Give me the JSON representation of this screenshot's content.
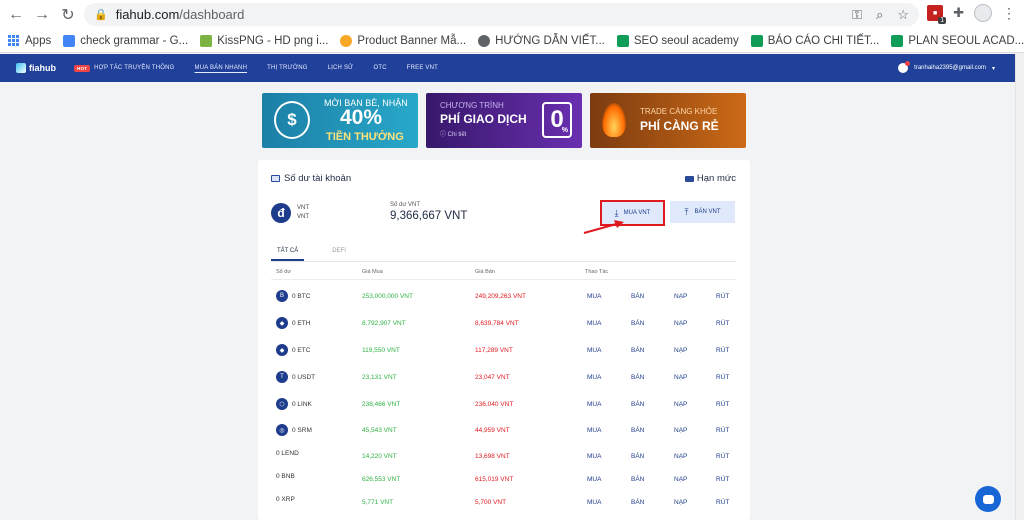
{
  "browser": {
    "url_host": "fiahub.com",
    "url_path": "/dashboard",
    "bookmarks": [
      {
        "label": "Apps",
        "color": "#4285f4"
      },
      {
        "label": "check grammar - G...",
        "color": "#4285f4"
      },
      {
        "label": "KissPNG - HD png i...",
        "color": "#7cb342"
      },
      {
        "label": "Product Banner Mẫ...",
        "color": "#f9a825"
      },
      {
        "label": "HƯỚNG DẪN VIẾT...",
        "color": "#4285f4"
      },
      {
        "label": "SEO seoul academy",
        "color": "#0f9d58"
      },
      {
        "label": "BÁO CÁO CHI TIẾT...",
        "color": "#0f9d58"
      },
      {
        "label": "PLAN SEOUL ACAD...",
        "color": "#0f9d58"
      }
    ],
    "ext_badge_count": "1"
  },
  "nav": {
    "logo": "fiahub",
    "hot": "HOT",
    "items": [
      "HỢP TÁC TRUYỀN THÔNG",
      "MUA BÁN NHANH",
      "THỊ TRƯỜNG",
      "LỊCH SỬ",
      "OTC",
      "FREE VNT"
    ],
    "active_index": 1,
    "user_email": "tranhaiha2395@gmail.com",
    "caret": "▾"
  },
  "banners": {
    "b1_line1": "MỜI BẠN BÈ, NHẬN",
    "b1_percent": "40%",
    "b1_line3": "TIỀN THƯỞNG",
    "b2_line1": "CHƯƠNG TRÌNH",
    "b2_line2": "PHÍ GIAO DỊCH",
    "b2_detail": "Chi tiết",
    "b2_zero": "0",
    "b2_pct": "%",
    "b3_line1": "TRADE CÀNG KHỎE",
    "b3_line2": "PHÍ CÀNG RẺ"
  },
  "account": {
    "title": "Số dư tài khoản",
    "limit_link": "Hạn mức",
    "currency_code": "VNT",
    "currency_name": "VNT",
    "balance_caption": "Số dư VNT",
    "balance_value": "9,366,667 VNT",
    "buy_button": "MUA VNT",
    "sell_button": "BÁN VNT",
    "highlight_color": "#e0191f"
  },
  "tabs": [
    "TẤT CẢ",
    "DEFI"
  ],
  "table": {
    "headers": [
      "Số dư",
      "Giá Mua",
      "Giá Bán",
      "Thao Tác"
    ],
    "actions": [
      "MUA",
      "BÁN",
      "NẠP",
      "RÚT"
    ],
    "rows": [
      {
        "balance": "0 BTC",
        "buy": "253,000,000 VNT",
        "sell": "249,209,263 VNT",
        "icon": "B"
      },
      {
        "balance": "0 ETH",
        "buy": "8,792,907 VNT",
        "sell": "8,639,784 VNT",
        "icon": "◆"
      },
      {
        "balance": "0 ETC",
        "buy": "119,550 VNT",
        "sell": "117,289 VNT",
        "icon": "◆"
      },
      {
        "balance": "0 USDT",
        "buy": "23,131 VNT",
        "sell": "23,047 VNT",
        "icon": "T"
      },
      {
        "balance": "0 LINK",
        "buy": "238,466 VNT",
        "sell": "236,040 VNT",
        "icon": "⬡"
      },
      {
        "balance": "0 SRM",
        "buy": "45,543 VNT",
        "sell": "44,959 VNT",
        "icon": "◎"
      },
      {
        "balance": "0 LEND",
        "buy": "14,220 VNT",
        "sell": "13,698 VNT",
        "icon": ""
      },
      {
        "balance": "0 BNB",
        "buy": "626,553 VNT",
        "sell": "615,019 VNT",
        "icon": ""
      },
      {
        "balance": "0 XRP",
        "buy": "5,771 VNT",
        "sell": "5,700 VNT",
        "icon": ""
      }
    ]
  }
}
